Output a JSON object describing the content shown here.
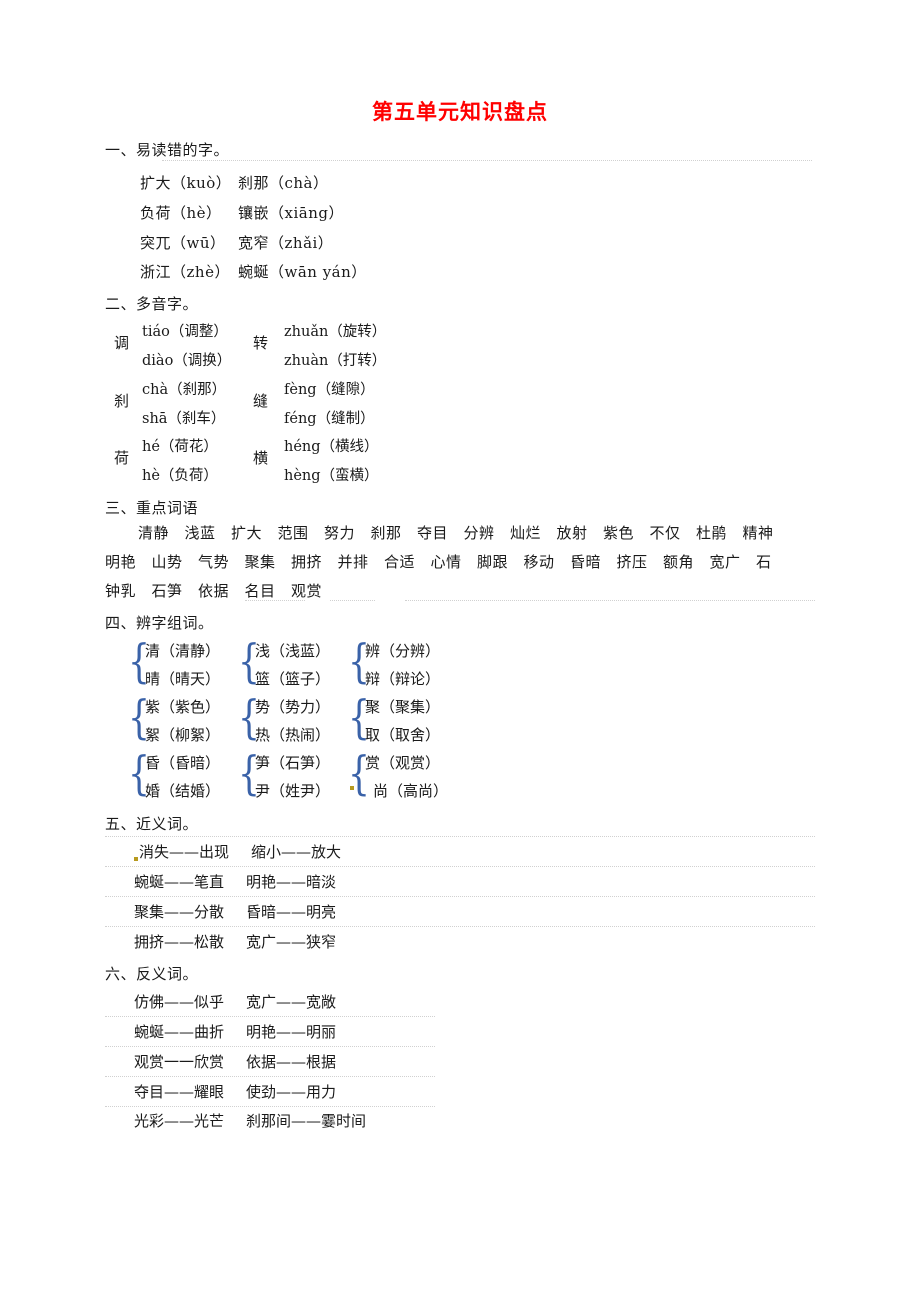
{
  "document": {
    "title": "第五单元知识盘点",
    "title_color": "#ff0000",
    "brace_color": "#3a62a8"
  },
  "sections": {
    "s1": {
      "heading": "一、易读错的字。",
      "rows": [
        {
          "left": "扩大（kuò）",
          "right": "刹那（chà）"
        },
        {
          "left": "负荷（hè）",
          "right": "镶嵌（xiāng）"
        },
        {
          "left": "突兀（wū）",
          "right": "宽窄（zhǎi）"
        },
        {
          "left": "浙江（zhè）",
          "right": "蜿蜒（wān yán）"
        }
      ]
    },
    "s2": {
      "heading": "二、多音字。",
      "groups": [
        {
          "char": "调",
          "r1": "tiáo（调整）",
          "r2": "diào（调换）"
        },
        {
          "char": "转",
          "r1": "zhuǎn（旋转）",
          "r2": "zhuàn（打转）"
        },
        {
          "char": "刹",
          "r1": "chà（刹那）",
          "r2": "shā（刹车）"
        },
        {
          "char": "缝",
          "r1": "fèng（缝隙）",
          "r2": "féng（缝制）"
        },
        {
          "char": "荷",
          "r1": "hé（荷花）",
          "r2": "hè（负荷）"
        },
        {
          "char": "横",
          "r1": "héng（横线）",
          "r2": "hèng（蛮横）"
        }
      ]
    },
    "s3": {
      "heading": "三、重点词语",
      "line1": "清静　浅蓝　扩大　范围　努力　刹那　夺目　分辨　灿烂　放射　紫色　不仅　杜鹃　精神",
      "line2": "明艳　山势　气势　聚集　拥挤　并排　合适　心情　脚跟　移动　昏暗　挤压　额角　宽广　石",
      "line3": "钟乳　石笋　依据　名目　观赏",
      "words": [
        "清静",
        "浅蓝",
        "扩大",
        "范围",
        "努力",
        "刹那",
        "夺目",
        "分辨",
        "灿烂",
        "放射",
        "紫色",
        "不仅",
        "杜鹃",
        "精神",
        "明艳",
        "山势",
        "气势",
        "聚集",
        "拥挤",
        "并排",
        "合适",
        "心情",
        "脚跟",
        "移动",
        "昏暗",
        "挤压",
        "额角",
        "宽广",
        "石钟乳",
        "石笋",
        "依据",
        "名目",
        "观赏"
      ]
    },
    "s4": {
      "heading": "四、辨字组词。",
      "groups": [
        {
          "top": "清（清静）",
          "bottom": "晴（晴天）"
        },
        {
          "top": "浅（浅蓝）",
          "bottom": "篮（篮子）"
        },
        {
          "top": "辨（分辨）",
          "bottom": "辩（辩论）"
        },
        {
          "top": "紫（紫色）",
          "bottom": "絮（柳絮）"
        },
        {
          "top": "势（势力）",
          "bottom": "热（热闹）"
        },
        {
          "top": "聚（聚集）",
          "bottom": "取（取舍）"
        },
        {
          "top": "昏（昏暗）",
          "bottom": "婚（结婚）"
        },
        {
          "top": "笋（石笋）",
          "bottom": "尹（姓尹）"
        },
        {
          "top": "赏（观赏）",
          "bottom": "尚（高尚）"
        }
      ]
    },
    "s5": {
      "heading": "五、近义词。",
      "rows": [
        {
          "left": "消失——出现",
          "right": "缩小——放大"
        },
        {
          "left": "蜿蜒——笔直",
          "right": "明艳——暗淡"
        },
        {
          "left": "聚集——分散",
          "right": "昏暗——明亮"
        },
        {
          "left": "拥挤——松散",
          "right": "宽广——狭窄"
        }
      ]
    },
    "s6": {
      "heading": "六、反义词。",
      "rows": [
        {
          "left": "仿佛——似乎",
          "right": "宽广——宽敞"
        },
        {
          "left": "蜿蜒——曲折",
          "right": "明艳——明丽"
        },
        {
          "left": "观赏一一欣赏",
          "right": "依据——根据"
        },
        {
          "left": "夺目——耀眼",
          "right": "使劲——用力"
        },
        {
          "left": "光彩——光芒",
          "right": "刹那间——霎时间"
        }
      ]
    }
  }
}
